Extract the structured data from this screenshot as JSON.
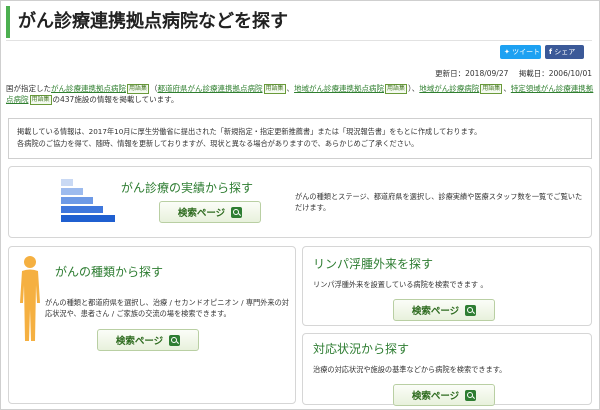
{
  "page": {
    "title": "がん診療連携拠点病院などを探す"
  },
  "sns": {
    "tweet_label": "ツイート",
    "share_label": "シェア",
    "accent_twitter": "#1da1f2",
    "accent_facebook": "#3b5998"
  },
  "dates": {
    "updated": "更新日：2018/09/27",
    "published": "掲載日：2006/10/01"
  },
  "intro": {
    "prefix": "国が指定した",
    "link1": "がん診療連携拠点病院",
    "tag": "用語集",
    "open1": "（",
    "link2": "都道府県がん診療連携拠点病院",
    "sep": "、",
    "link3": "地域がん診療連携拠点病院",
    "close1": "）、",
    "link4": "地域がん診療病院",
    "sep2": "、",
    "link5": "特定領域がん診療連携拠点病院",
    "suffix": "の437施設の情報を掲載しています。"
  },
  "notice": {
    "line1": "掲載している情報は、2017年10月に厚生労働省に提出された「新規指定・指定更新推薦書」または「現況報告書」をもとに作成しております。",
    "line2": "各病院のご協力を得て、随時、情報を更新しておりますが、現状と異なる場合がありますので、あらかじめご了承ください。"
  },
  "cards": {
    "performance": {
      "title": "がん診療の実績から探す",
      "desc": "がんの種類とステージ、都道府県を選択し、診療実績や医療スタッフ数を一覧でご覧いただけます。",
      "button": "検索ページ"
    },
    "cancer_type": {
      "title": "がんの種類から探す",
      "desc": "がんの種類と都道府県を選択し、治療 / セカンドオピニオン / 専門外来の対応状況や、患者さん / ご家族の交流の場を検索できます。",
      "button": "検索ページ"
    },
    "lymphedema": {
      "title": "リンパ浮腫外来を探す",
      "desc": "リンパ浮腫外来を設置している病院を検索できます 。",
      "button": "検索ページ"
    },
    "response": {
      "title": "対応状況から探す",
      "desc": "治療の対応状況や施設の基準などから病院を検索できます。",
      "button": "検索ページ"
    }
  },
  "colors": {
    "accent_green": "#2e7d32",
    "title_bar": "#4caf50",
    "stair_blue": "#1f5fd0",
    "figure_orange": "#f5b041"
  }
}
